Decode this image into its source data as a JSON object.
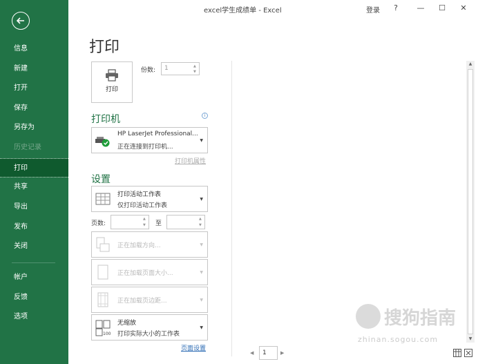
{
  "window": {
    "title": "excel学生成绩单  -  Excel",
    "login": "登录",
    "help": "?",
    "minimize": "—",
    "restore": "☐",
    "close": "✕"
  },
  "sidebar": {
    "items": [
      {
        "label": "信息"
      },
      {
        "label": "新建"
      },
      {
        "label": "打开"
      },
      {
        "label": "保存"
      },
      {
        "label": "另存为"
      },
      {
        "label": "历史记录"
      },
      {
        "label": "打印"
      },
      {
        "label": "共享"
      },
      {
        "label": "导出"
      },
      {
        "label": "发布"
      },
      {
        "label": "关闭"
      },
      {
        "label": "帐户"
      },
      {
        "label": "反馈"
      },
      {
        "label": "选项"
      }
    ]
  },
  "print": {
    "title": "打印",
    "button_label": "打印",
    "copies_label": "份数:",
    "copies_value": "1"
  },
  "printer": {
    "section_title": "打印机",
    "name": "HP LaserJet Professional...",
    "status": "正在连接到打印机...",
    "properties_link": "打印机属性"
  },
  "settings": {
    "section_title": "设置",
    "scope_line1": "打印活动工作表",
    "scope_line2": "仅打印活动工作表",
    "pages_label": "页数:",
    "to_label": "至",
    "orientation": "正在加载方向...",
    "page_size": "正在加载页面大小...",
    "margins": "正在加载页边距...",
    "scaling_line1": "无缩放",
    "scaling_line2": "打印实际大小的工作表",
    "page_setup_link": "页面设置"
  },
  "preview": {
    "page_number": "1"
  },
  "watermark": {
    "text": "搜狗指南",
    "url": "zhinan.sogou.com"
  }
}
